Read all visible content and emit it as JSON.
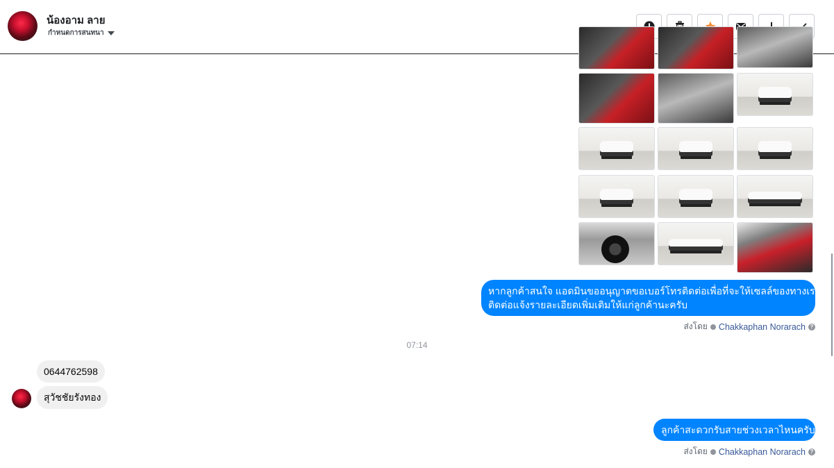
{
  "header": {
    "contact_name": "น้องอาม ลาย",
    "assign_label": "กำหนดการสนทนา",
    "actions": [
      {
        "icon": "alert-circle-icon",
        "name": "report-button"
      },
      {
        "icon": "trash-icon",
        "name": "delete-button"
      },
      {
        "icon": "star-icon",
        "name": "star-button",
        "color": "#f7923b"
      },
      {
        "icon": "envelope-icon",
        "name": "mark-unread-button"
      },
      {
        "icon": "exclamation-icon",
        "name": "spam-button"
      },
      {
        "icon": "check-icon",
        "name": "done-button"
      }
    ]
  },
  "gallery": {
    "rows": 5,
    "columns": 3,
    "images": [
      "interior-red",
      "interior-red",
      "interior-grey",
      "interior-red",
      "interior-grey",
      "car-white",
      "car-white",
      "car-white",
      "car-white",
      "car-white",
      "car-white",
      "car-white-side",
      "wheel",
      "car-white-side",
      "seat"
    ]
  },
  "messages": {
    "out_1": {
      "line1": "หากลูกค้าสนใจ แอดมินขออนุญาตขอเบอร์โทรติดต่อเพื่อที่จะให้เซลล์ของทางเรา",
      "line2": "ติดต่อแจ้งรายละเอียดเพิ่มเติมให้แก่ลูกค้านะครับ"
    },
    "sent_by_1": {
      "prefix": "ส่งโดย",
      "name": "Chakkaphan Norarach"
    },
    "timestamp": "07:14",
    "in_1": "0644762598",
    "in_2": "สุวัชชัยรังทอง",
    "out_2": "ลูกค้าสะดวกรับสายช่วงเวลาไหนครับ",
    "sent_by_2": {
      "prefix": "ส่งโดย",
      "name": "Chakkaphan Norarach"
    }
  },
  "colors": {
    "accent": "#0084ff",
    "star": "#f7923b",
    "link": "#385898"
  }
}
